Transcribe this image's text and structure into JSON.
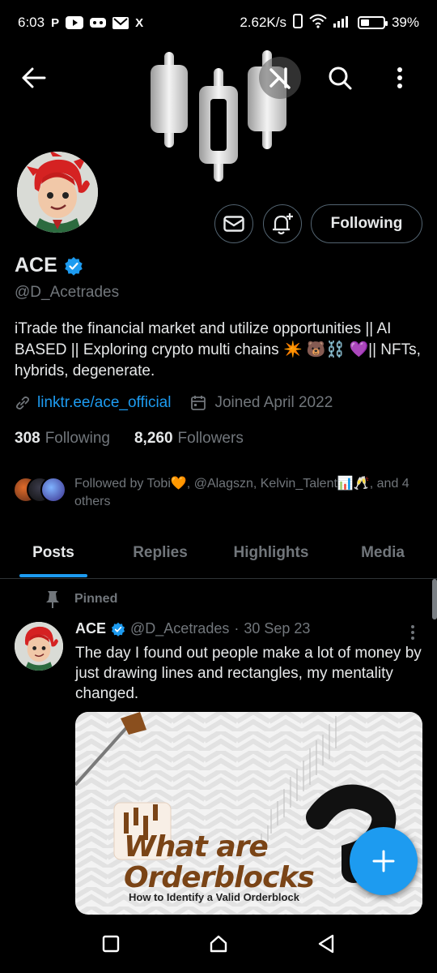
{
  "status_bar": {
    "time": "6:03",
    "app_icons": [
      "P",
      "youtube-icon",
      "game-icon",
      "gmail-icon",
      "X"
    ],
    "net_speed": "2.62K/s",
    "battery_percent": "39%",
    "battery_level": 0.39
  },
  "colors": {
    "accent": "#1d9bf0",
    "muted": "#71767b",
    "text": "#e7e9ea",
    "border": "#2f3336",
    "heart": "#f4900c"
  },
  "profile": {
    "name": "ACE",
    "handle": "@D_Acetrades",
    "bio": "iTrade the financial market and utilize opportunities || AI BASED || Exploring crypto multi chains ✴️ 🐻⛓️ 💜||  NFTs, hybrids, degenerate.",
    "link": "linktr.ee/ace_official",
    "joined": "Joined April 2022",
    "following_count": "308",
    "following_label": "Following",
    "followers_count": "8,260",
    "followers_label": "Followers",
    "following_button": "Following",
    "followed_by": "Followed by Tobi🧡, @Alagszn, Kelvin_Talent📊🥂, and 4 others"
  },
  "tabs": [
    {
      "label": "Posts",
      "active": true
    },
    {
      "label": "Replies",
      "active": false
    },
    {
      "label": "Highlights",
      "active": false
    },
    {
      "label": "Media",
      "active": false
    }
  ],
  "post": {
    "pinned_label": "Pinned",
    "author": "ACE",
    "handle": "@D_Acetrades",
    "separator": "·",
    "date": "30 Sep 23",
    "text": "The day I found out people make a lot of money by just drawing lines and rectangles, my mentality changed.",
    "media_title_line1": "What are",
    "media_title_line2": "Orderblocks",
    "media_subtitle": "How to Identify a Valid Orderblock"
  },
  "fab_label": "+",
  "icons": {
    "back": "back-arrow-icon",
    "grok": "grok-icon",
    "search": "search-icon",
    "more": "more-vertical-icon",
    "message": "envelope-icon",
    "notify": "bell-plus-icon",
    "link": "link-icon",
    "calendar": "calendar-icon",
    "verified": "verified-badge-icon",
    "pin": "pin-icon"
  }
}
